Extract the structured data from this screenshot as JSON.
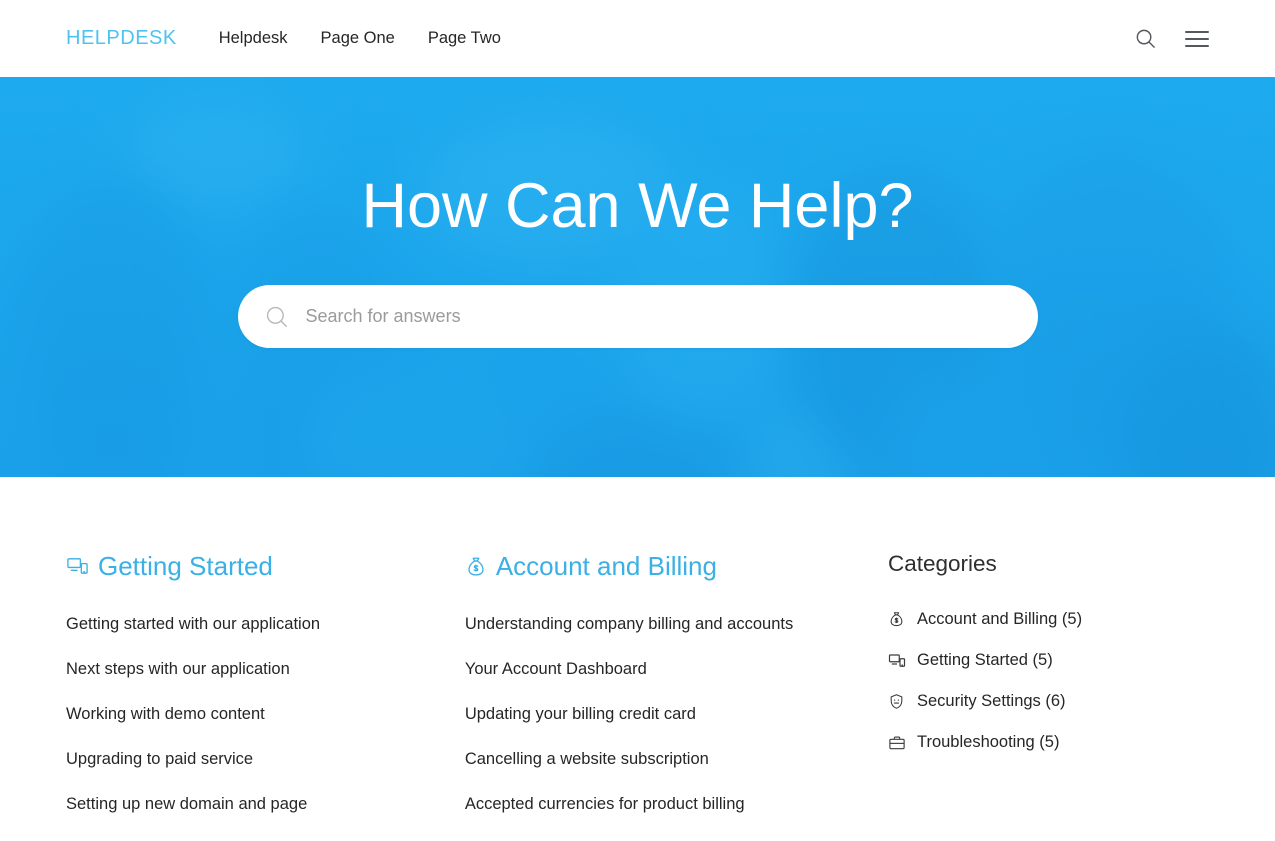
{
  "header": {
    "brand": "HELPDESK",
    "nav": [
      {
        "label": "Helpdesk"
      },
      {
        "label": "Page One"
      },
      {
        "label": "Page Two"
      }
    ],
    "search_icon": "search-icon",
    "menu_icon": "hamburger-menu-icon"
  },
  "hero": {
    "title": "How Can We Help?",
    "search_placeholder": "Search for answers",
    "search_value": "",
    "search_icon": "search-icon",
    "overlay_color": "#1eaaee"
  },
  "sections": [
    {
      "title": "Getting Started",
      "icon": "devices-icon",
      "color": "#3ab0e6",
      "links": [
        "Getting started with our application",
        "Next steps with our application",
        "Working with demo content",
        "Upgrading to paid service",
        "Setting up new domain and page"
      ]
    },
    {
      "title": "Account and Billing",
      "icon": "money-bag-icon",
      "color": "#3ab0e6",
      "links": [
        "Understanding company billing and accounts",
        "Your Account Dashboard",
        "Updating your billing credit card",
        "Cancelling a website subscription",
        "Accepted currencies for product billing"
      ]
    }
  ],
  "categories": {
    "title": "Categories",
    "items": [
      {
        "label": "Account and Billing (5)",
        "icon": "money-bag-icon"
      },
      {
        "label": "Getting Started (5)",
        "icon": "devices-icon"
      },
      {
        "label": "Security Settings (6)",
        "icon": "shield-icon"
      },
      {
        "label": "Troubleshooting (5)",
        "icon": "briefcase-icon"
      }
    ]
  },
  "colors": {
    "brand": "#4cc3f0",
    "heading": "#3ab0e6",
    "hero_blue": "#1eaaee",
    "text": "#262626"
  }
}
